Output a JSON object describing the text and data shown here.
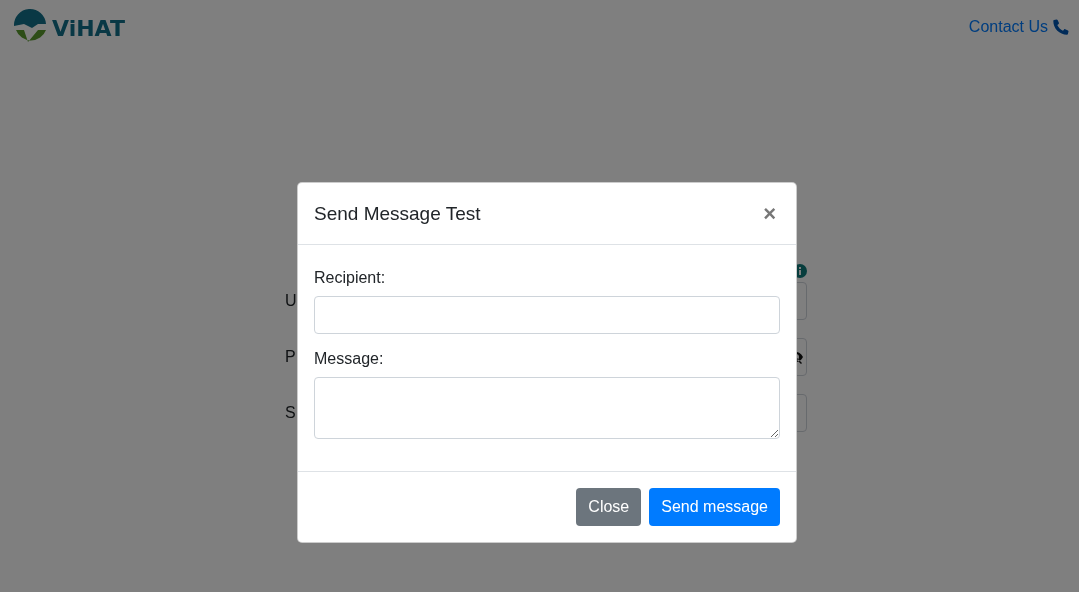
{
  "header": {
    "logo_text": "ViHAT",
    "contact_link": "Contact Us"
  },
  "form": {
    "rows": [
      {
        "label": "U",
        "kind": "info"
      },
      {
        "label": "P",
        "kind": "password"
      },
      {
        "label": "S",
        "kind": "plain"
      }
    ]
  },
  "modal": {
    "title": "Send Message Test",
    "close_symbol": "×",
    "fields": [
      {
        "label": "Recipient:",
        "kind": "input"
      },
      {
        "label": "Message:",
        "kind": "textarea"
      }
    ],
    "buttons": [
      {
        "label": "Close",
        "kind": "secondary"
      },
      {
        "label": "Send message",
        "kind": "primary"
      }
    ]
  }
}
